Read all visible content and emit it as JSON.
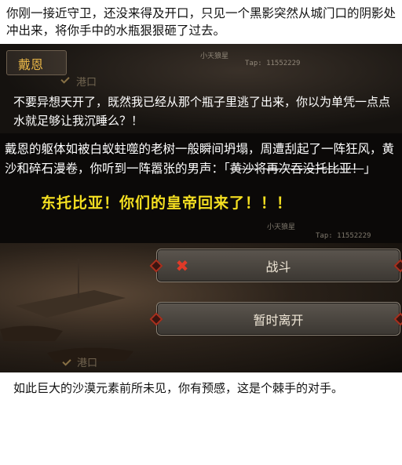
{
  "top_narration": {
    "text": "你刚一接近守卫，还没来得及开口，只见一个黑影突然从城门口的阴影处冲出来，将你手中的水瓶狠狠砸了过去。"
  },
  "watermark": {
    "name": "小天狼星",
    "tap": "Tap: 11552229"
  },
  "location_label": "港口",
  "speaker": {
    "name": "戴恩",
    "name_color": "#e8b547",
    "line": "不要异想天开了，既然我已经从那个瓶子里逃了出来，你以为单凭一点点水就足够让我沉睡么？！"
  },
  "narration2": {
    "text_before": "戴恩的躯体如被白蚁蛀噬的老树一般瞬间坍塌，周遭刮起了一阵狂风，黄沙和碎石漫卷，你听到一阵嚣张的男声：「",
    "struck_text": "黄沙将再次吞没托比亚！",
    "text_after": "」",
    "shout": "东托比亚！你们的皇帝回来了！！！",
    "shout_color": "#f5e021"
  },
  "buttons": {
    "fight_label": "战斗",
    "leave_label": "暂时离开",
    "fight_icon": "crossed-swords-icon"
  },
  "bottom_narration": {
    "text": "如此巨大的沙漠元素前所未见，你有预感，这是个棘手的对手。"
  },
  "colors": {
    "accent_red": "#a8301e",
    "button_text": "#efe6d6"
  }
}
